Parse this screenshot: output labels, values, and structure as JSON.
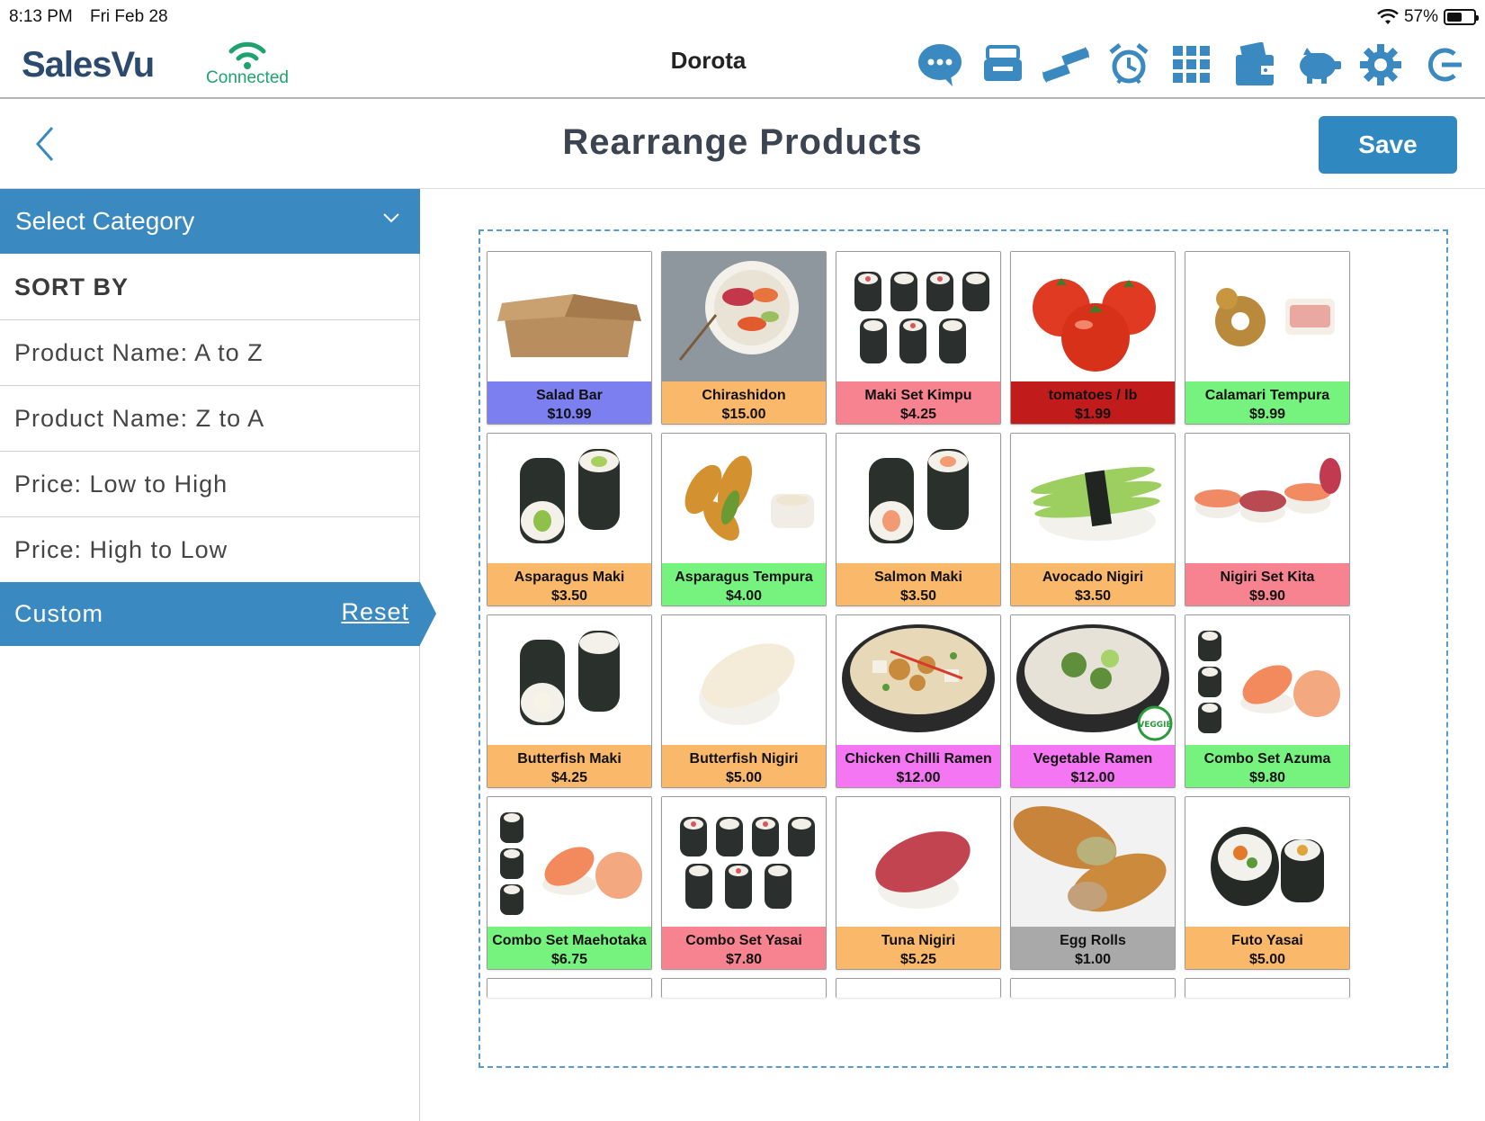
{
  "status_bar": {
    "time": "8:13 PM",
    "date": "Fri Feb 28",
    "battery": "57%",
    "battery_level": 0.57
  },
  "header": {
    "logo": "SalesVu",
    "connection_label": "Connected",
    "user_name": "Dorota",
    "toolbar_icons": [
      "chat-icon",
      "register-icon",
      "transfer-arrows-icon",
      "alarm-clock-icon",
      "grid-icon",
      "wallet-icon",
      "piggy-bank-icon",
      "gear-icon",
      "logout-icon"
    ],
    "icon_color": "#3a89c0"
  },
  "page": {
    "title": "Rearrange Products",
    "save_label": "Save"
  },
  "sidebar": {
    "select_category": "Select Category",
    "sort_by": "SORT BY",
    "options": [
      "Product Name: A to Z",
      "Product Name: Z to A",
      "Price: Low to High",
      "Price: High to Low"
    ],
    "custom_label": "Custom",
    "reset_label": "Reset"
  },
  "products": [
    {
      "name": "Salad Bar",
      "price": "$10.99",
      "color": "#7b7ff0",
      "img": "box"
    },
    {
      "name": "Chirashidon",
      "price": "$15.00",
      "color": "#f9b86a",
      "img": "bowl"
    },
    {
      "name": "Maki Set Kimpu",
      "price": "$4.25",
      "color": "#f6838f",
      "img": "maki6"
    },
    {
      "name": "tomatoes / lb",
      "price": "$1.99",
      "color": "#c21b1b",
      "img": "tomato"
    },
    {
      "name": "Calamari Tempura",
      "price": "$9.99",
      "color": "#76f27e",
      "img": "calamari"
    },
    {
      "name": "Asparagus Maki",
      "price": "$3.50",
      "color": "#f9b86a",
      "img": "maki2green"
    },
    {
      "name": "Asparagus Tempura",
      "price": "$4.00",
      "color": "#76f27e",
      "img": "tempura"
    },
    {
      "name": "Salmon Maki",
      "price": "$3.50",
      "color": "#f9b86a",
      "img": "maki2salmon"
    },
    {
      "name": "Avocado Nigiri",
      "price": "$3.50",
      "color": "#f9b86a",
      "img": "nigiriavocado"
    },
    {
      "name": "Nigiri Set Kita",
      "price": "$9.90",
      "color": "#f6838f",
      "img": "nigiriset"
    },
    {
      "name": "Butterfish Maki",
      "price": "$4.25",
      "color": "#f9b86a",
      "img": "maki2white"
    },
    {
      "name": "Butterfish Nigiri",
      "price": "$5.00",
      "color": "#f9b86a",
      "img": "nigiriwhite"
    },
    {
      "name": "Chicken Chilli Ramen",
      "price": "$12.00",
      "color": "#f576f2",
      "img": "ramen"
    },
    {
      "name": "Vegetable Ramen",
      "price": "$12.00",
      "color": "#f576f2",
      "img": "ramenveg"
    },
    {
      "name": "Combo Set Azuma",
      "price": "$9.80",
      "color": "#76f27e",
      "img": "combo"
    },
    {
      "name": "Combo Set Maehotaka",
      "price": "$6.75",
      "color": "#76f27e",
      "img": "combo"
    },
    {
      "name": "Combo Set Yasai",
      "price": "$7.80",
      "color": "#f6838f",
      "img": "maki6"
    },
    {
      "name": "Tuna Nigiri",
      "price": "$5.25",
      "color": "#f9b86a",
      "img": "nigirituna"
    },
    {
      "name": "Egg Rolls",
      "price": "$1.00",
      "color": "#a9a9a9",
      "img": "eggroll"
    },
    {
      "name": "Futo Yasai",
      "price": "$5.00",
      "color": "#f9b86a",
      "img": "futo"
    }
  ],
  "partial_row_count": 5
}
